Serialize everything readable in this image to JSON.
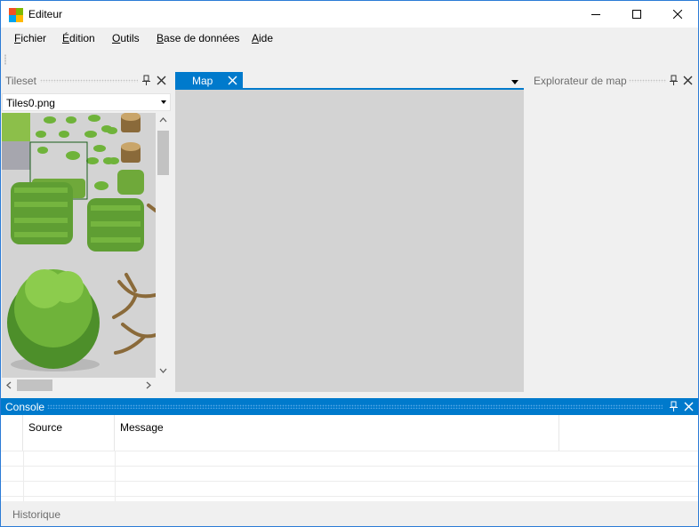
{
  "window": {
    "title": "Editeur"
  },
  "menu": {
    "items": [
      {
        "label": "Fichier",
        "mnemonic": "F",
        "rest": "ichier"
      },
      {
        "label": "Édition",
        "mnemonic": "É",
        "rest": "dition"
      },
      {
        "label": "Outils",
        "mnemonic": "O",
        "rest": "utils"
      },
      {
        "label": "Base de données",
        "mnemonic": "B",
        "rest": "ase de données"
      },
      {
        "label": "Aide",
        "mnemonic": "A",
        "rest": "ide"
      }
    ]
  },
  "tileset": {
    "title": "Tileset",
    "selected_file": "Tiles0.png"
  },
  "document": {
    "tab_label": "Map"
  },
  "explorer": {
    "title": "Explorateur de map"
  },
  "console": {
    "title": "Console",
    "columns": [
      "Source",
      "Message"
    ]
  },
  "bottom_tabs": {
    "history": "Historique"
  },
  "icons": {
    "pin": "pin-icon",
    "close": "close-icon",
    "minimize": "minimize-icon",
    "maximize": "maximize-icon"
  },
  "colors": {
    "accent": "#007acc",
    "canvas": "#d3d3d3",
    "chrome": "#f0f0f0",
    "grass": "#6fa93a",
    "tree": "#4d8f2a"
  }
}
